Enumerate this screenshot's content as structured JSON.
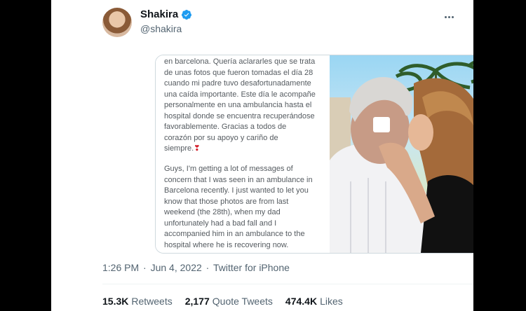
{
  "header": {
    "display_name": "Shakira",
    "handle": "@shakira"
  },
  "media": {
    "text_paragraph_1": "en barcelona. Quería aclararles que se trata\nde unas fotos que fueron tomadas el día 28\ncuando mi padre tuvo desafortunadamente\nuna caída importante. Este día le acompañe\npersonalmente en una ambulancia hasta el\nhospital donde se encuentra recuperándose\nfavorablemente. Gracias a todos de\ncorazón por su apoyo y cariño de\nsiempre.",
    "heart_emoji": "❣",
    "text_paragraph_2": "Guys, I'm getting a lot of messages of\nconcern that I was seen in an ambulance in\nBarcelona recently. I just wanted to let you\nknow that those photos are from last\nweekend (the 28th), when my dad\nunfortunately had a bad fall and I\naccompanied him in an ambulance to the\nhospital where he is recovering now."
  },
  "meta": {
    "time": "1:26 PM",
    "separator": "·",
    "date": "Jun 4, 2022",
    "source": "Twitter for iPhone"
  },
  "stats": {
    "retweets_count": "15.3K",
    "retweets_label": "Retweets",
    "quotes_count": "2,177",
    "quotes_label": "Quote Tweets",
    "likes_count": "474.4K",
    "likes_label": "Likes"
  },
  "colors": {
    "verified_badge": "#1d9bf0",
    "background": "#000000"
  }
}
